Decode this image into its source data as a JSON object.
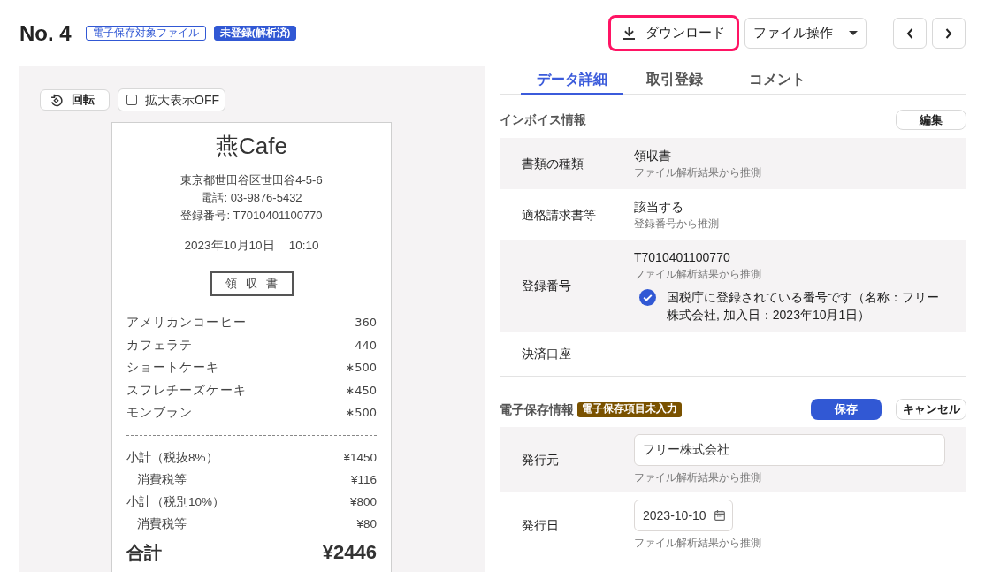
{
  "header": {
    "title": "No. 4",
    "badges": [
      {
        "label": "電子保存対象ファイル",
        "kind": "outline"
      },
      {
        "label": "未登録(解析済)",
        "kind": "filled"
      }
    ]
  },
  "toolbar": {
    "download_button": {
      "label": "ダウンロード",
      "highlighted": true
    },
    "file_menu_button": "ファイル操作"
  },
  "preview": {
    "rotate_button": "回転",
    "zoom_toggle": {
      "label": "拡大表示OFF",
      "checked": false
    },
    "receipt": {
      "shop_name": "燕Cafe",
      "address_lines": [
        "東京都世田谷区世田谷4-5-6",
        "電話: 03-9876-5432",
        "登録番号: T7010401100770"
      ],
      "date": "2023年10月10日",
      "time": "10:10",
      "document_title": "領収書",
      "items": [
        {
          "name": "アメリカンコーヒー",
          "amount": "360"
        },
        {
          "name": "カフェラテ",
          "amount": "440"
        },
        {
          "name": "ショートケーキ",
          "amount": "∗500"
        },
        {
          "name": "スフレチーズケーキ",
          "amount": "∗450"
        },
        {
          "name": "モンブラン",
          "amount": "∗500"
        }
      ],
      "summary": [
        {
          "kind": "subtotal",
          "label": "小計（税抜8%）",
          "amount": "¥1450"
        },
        {
          "kind": "tax",
          "label": "消費税等",
          "amount": "¥116"
        },
        {
          "kind": "subtotal",
          "label": "小計（税別10%）",
          "amount": "¥800"
        },
        {
          "kind": "tax",
          "label": "消費税等",
          "amount": "¥80"
        }
      ],
      "total": {
        "label": "合計",
        "amount": "¥2446"
      }
    }
  },
  "tabs": [
    {
      "label": "データ詳細",
      "selected": true
    },
    {
      "label": "取引登録",
      "selected": false
    },
    {
      "label": "コメント",
      "selected": false
    }
  ],
  "invoice_info": {
    "title": "インボイス情報",
    "edit_button": "編集",
    "rows": [
      {
        "label": "書類の種類",
        "value": "領収書",
        "hint": "ファイル解析結果から推測"
      },
      {
        "label": "適格請求書等",
        "value": "該当する",
        "hint": "登録番号から推測"
      },
      {
        "label": "登録番号",
        "value": "T7010401100770",
        "hint": "ファイル解析結果から推測",
        "verification": {
          "verified": true,
          "text": "国税庁に登録されている番号です（名称：フリー株式会社, 加入日：2023年10月1日）"
        }
      },
      {
        "label": "決済口座"
      }
    ]
  },
  "storage_info": {
    "title": "電子保存情報",
    "badge": "電子保存項目未入力",
    "save_button": "保存",
    "cancel_button": "キャンセル",
    "fields": [
      {
        "label": "発行元",
        "kind": "text",
        "value": "フリー株式会社",
        "hint": "ファイル解析結果から推測"
      },
      {
        "label": "発行日",
        "kind": "date",
        "value": "2023-10-10",
        "hint": "ファイル解析結果から推測"
      }
    ]
  }
}
